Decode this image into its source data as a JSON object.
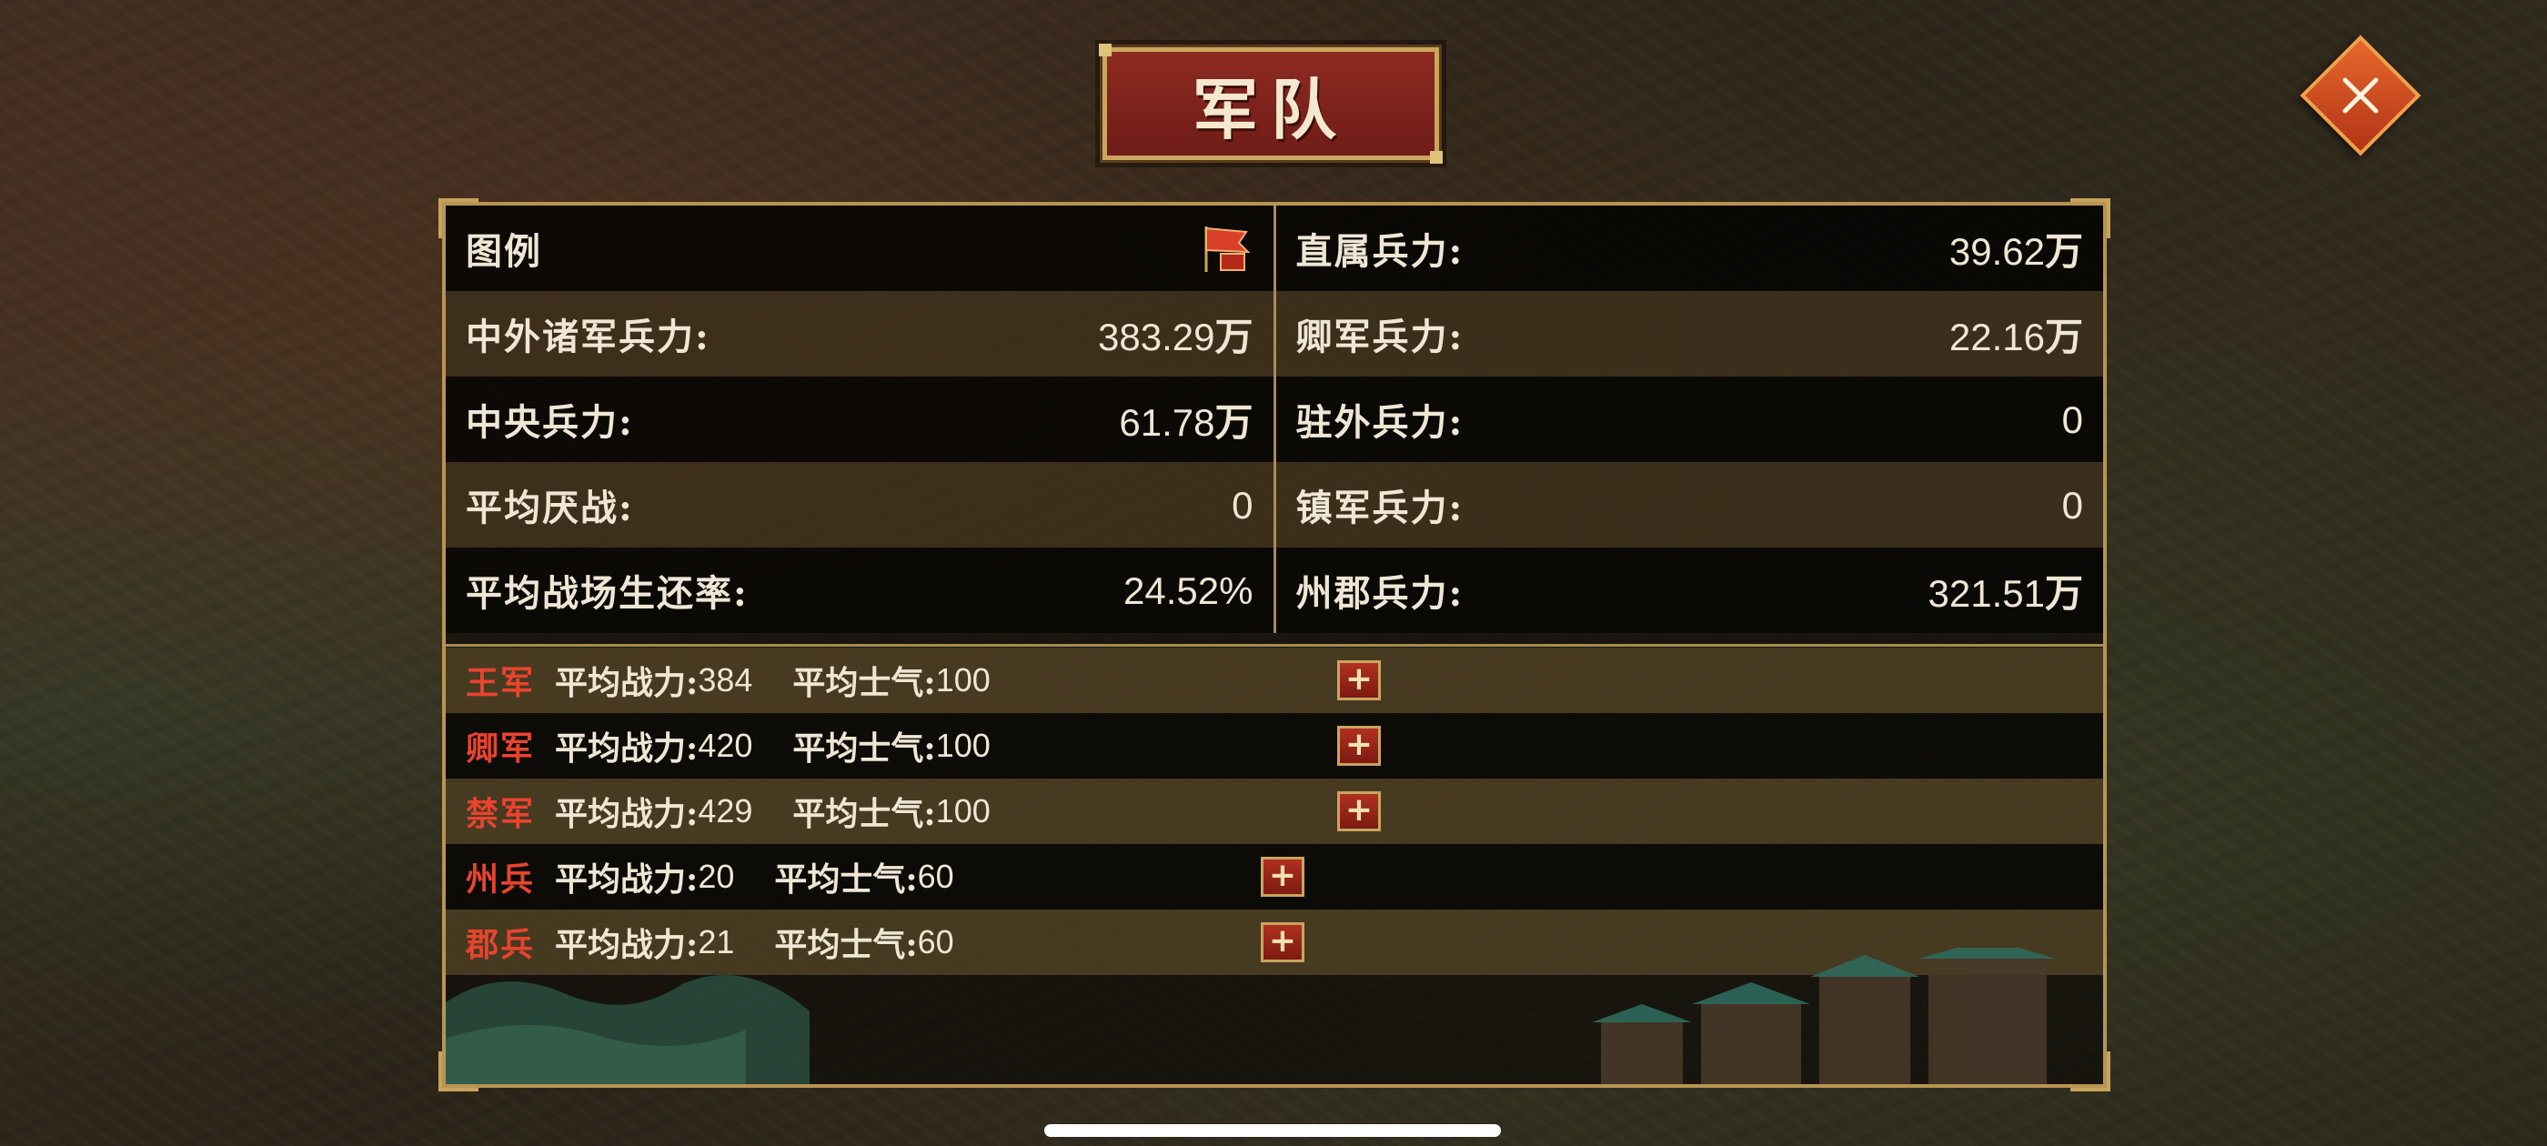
{
  "title": "军队",
  "close_icon": "close-icon",
  "stats": [
    {
      "left": {
        "label": "图例",
        "value": "",
        "icon": "legend-flag-icon"
      },
      "right": {
        "label": "直属兵力:",
        "value": "39.62",
        "unit": "万"
      }
    },
    {
      "left": {
        "label": "中外诸军兵力:",
        "value": "383.29",
        "unit": "万"
      },
      "right": {
        "label": "卿军兵力:",
        "value": "22.16",
        "unit": "万"
      }
    },
    {
      "left": {
        "label": "中央兵力:",
        "value": "61.78",
        "unit": "万"
      },
      "right": {
        "label": "驻外兵力:",
        "value": "0",
        "unit": ""
      }
    },
    {
      "left": {
        "label": "平均厌战:",
        "value": "0",
        "unit": ""
      },
      "right": {
        "label": "镇军兵力:",
        "value": "0",
        "unit": ""
      }
    },
    {
      "left": {
        "label": "平均战场生还率:",
        "value": "24.52%",
        "unit": ""
      },
      "right": {
        "label": "州郡兵力:",
        "value": "321.51",
        "unit": "万"
      }
    }
  ],
  "armies": [
    {
      "name": "王军",
      "power_label": "平均战力:",
      "power": "384",
      "morale_label": "平均士气:",
      "morale": "100"
    },
    {
      "name": "卿军",
      "power_label": "平均战力:",
      "power": "420",
      "morale_label": "平均士气:",
      "morale": "100"
    },
    {
      "name": "禁军",
      "power_label": "平均战力:",
      "power": "429",
      "morale_label": "平均士气:",
      "morale": "100"
    },
    {
      "name": "州兵",
      "power_label": "平均战力:",
      "power": "20",
      "morale_label": "平均士气:",
      "morale": "60"
    },
    {
      "name": "郡兵",
      "power_label": "平均战力:",
      "power": "21",
      "morale_label": "平均士气:",
      "morale": "60"
    }
  ],
  "plus_label": "+",
  "colors": {
    "accent_red": "#e8442e",
    "gold_border": "#b89452",
    "text": "#efe6d4"
  }
}
